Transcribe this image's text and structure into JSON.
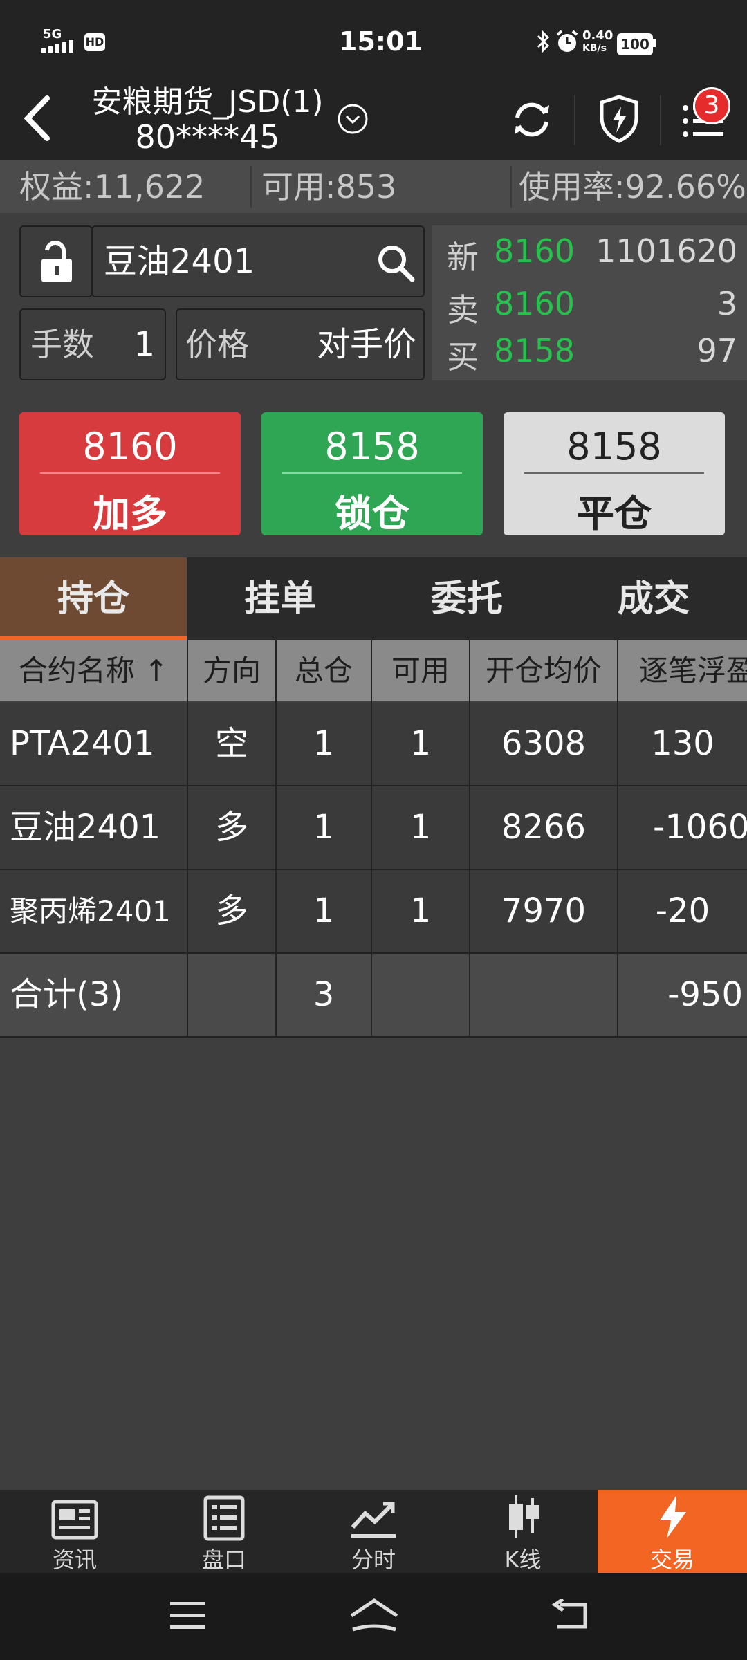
{
  "status_bar": {
    "network": "5G",
    "hd": "HD",
    "time": "15:01",
    "speed_value": "0.40",
    "speed_unit": "KB/s",
    "battery": "100"
  },
  "header": {
    "account_name": "安粮期货_JSD(1)",
    "account_id": "80****45",
    "notification_count": "3",
    "icons": [
      "back-arrow-icon",
      "chevron-down-circle-icon",
      "refresh-icon",
      "shield-bolt-icon",
      "menu-list-icon"
    ]
  },
  "account": {
    "equity": "权益:11,622",
    "available": "可用:853",
    "usage": "使用率:92.66%"
  },
  "order": {
    "contract": "豆油2401",
    "lots_label": "手数",
    "lots_value": "1",
    "price_label": "价格",
    "price_value": "对手价"
  },
  "quote": {
    "last_label": "新",
    "last_price": "8160",
    "volume": "1101620",
    "ask_label": "卖",
    "ask_price": "8160",
    "ask_qty": "3",
    "bid_label": "买",
    "bid_price": "8158",
    "bid_qty": "97"
  },
  "actions": {
    "buy_price": "8160",
    "buy_label": "加多",
    "lock_price": "8158",
    "lock_label": "锁仓",
    "close_price": "8158",
    "close_label": "平仓"
  },
  "tabs": [
    "持仓",
    "挂单",
    "委托",
    "成交"
  ],
  "table": {
    "headers": [
      "合约名称 ↑",
      "方向",
      "总仓",
      "可用",
      "开仓均价",
      "逐笔浮盈"
    ],
    "rows": [
      {
        "name": "PTA2401",
        "dir": "空",
        "total": "1",
        "avail": "1",
        "avg": "6308",
        "pnl": "130"
      },
      {
        "name": "豆油2401",
        "dir": "多",
        "total": "1",
        "avail": "1",
        "avg": "8266",
        "pnl": "-1060"
      },
      {
        "name": "聚丙烯2401",
        "dir": "多",
        "total": "1",
        "avail": "1",
        "avg": "7970",
        "pnl": "-20"
      }
    ],
    "summary": {
      "name": "合计(3)",
      "total": "3",
      "pnl": "-950"
    }
  },
  "bottom_nav": [
    "资讯",
    "盘口",
    "分时",
    "K线",
    "交易"
  ],
  "colors": {
    "accent_orange": "#f26522",
    "buy_red": "#d83b3d",
    "lock_green": "#2ea653",
    "up_red": "#f03a3a",
    "down_green": "#27c14d"
  }
}
